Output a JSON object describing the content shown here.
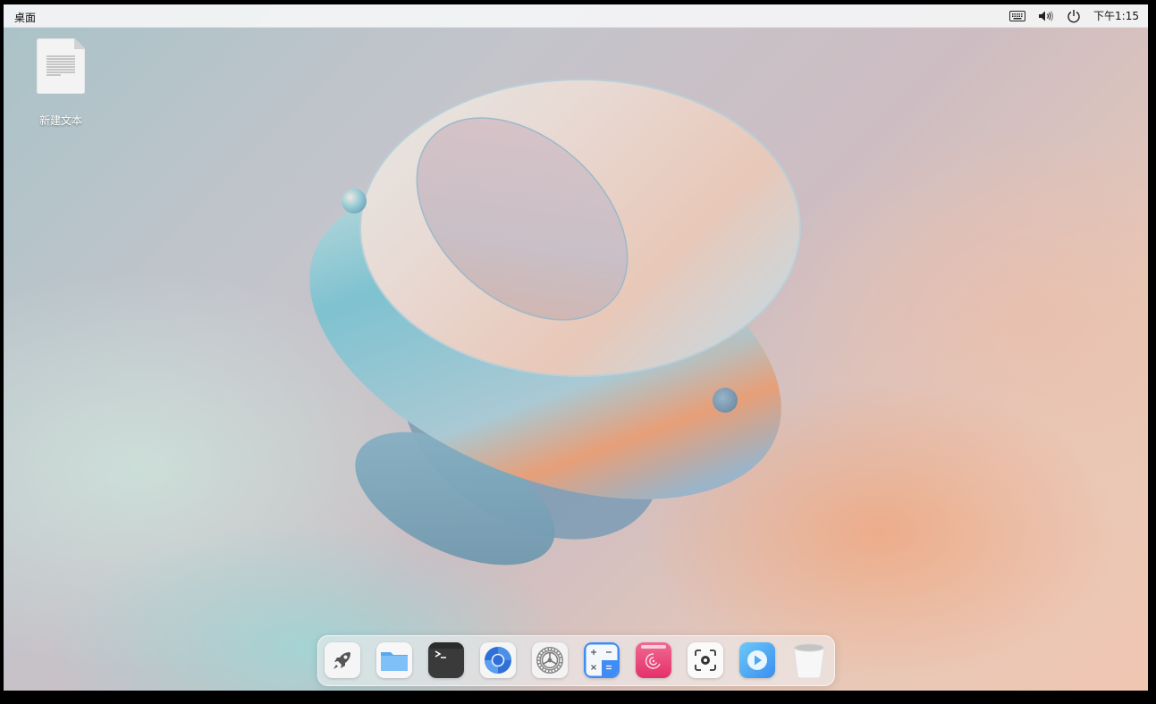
{
  "topbar": {
    "title": "桌面",
    "clock": "下午1:15",
    "tray_icons": [
      "keyboard-icon",
      "volume-icon",
      "power-icon"
    ]
  },
  "desktop": {
    "icons": [
      {
        "label": "新建文本",
        "icon": "text-document-icon"
      }
    ]
  },
  "dock": {
    "apps": [
      {
        "name": "launcher",
        "icon": "rocket-icon"
      },
      {
        "name": "file-manager",
        "icon": "folder-icon"
      },
      {
        "name": "terminal",
        "icon": "terminal-icon"
      },
      {
        "name": "browser",
        "icon": "browser-icon"
      },
      {
        "name": "control-center",
        "icon": "settings-gear-icon"
      },
      {
        "name": "calculator",
        "icon": "calculator-icon"
      },
      {
        "name": "app-store",
        "icon": "store-icon"
      },
      {
        "name": "screenshot",
        "icon": "screenshot-icon"
      },
      {
        "name": "video-player",
        "icon": "play-icon"
      },
      {
        "name": "trash",
        "icon": "trash-icon"
      }
    ]
  },
  "colors": {
    "topbar_bg": "#f4f5f6",
    "accent_blue": "#3f8cf5",
    "store_pink": "#ea3f79",
    "player_blue": "#4aa8f5"
  }
}
